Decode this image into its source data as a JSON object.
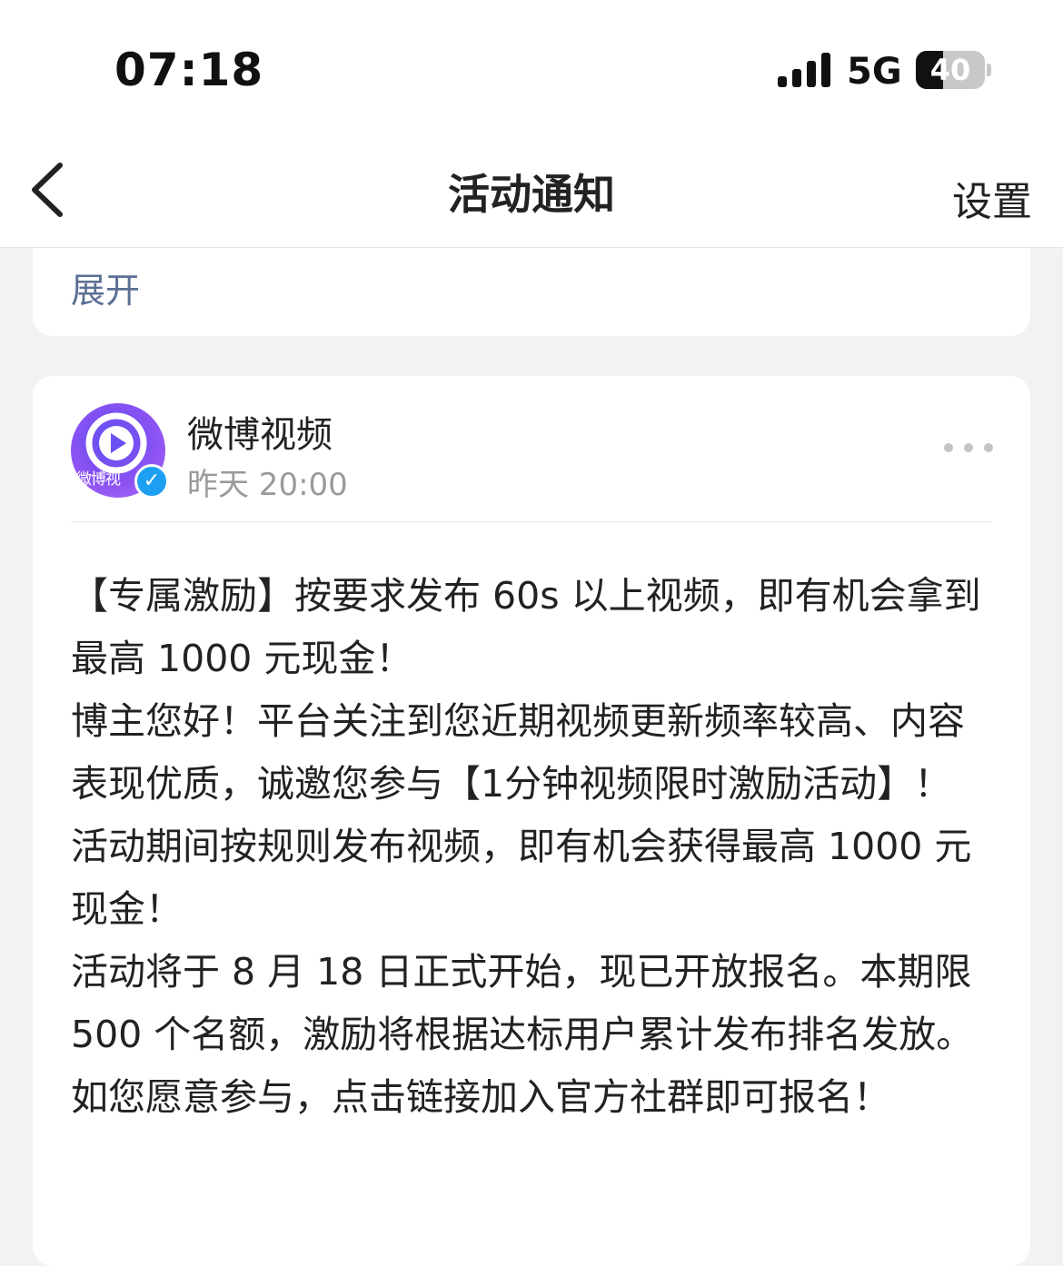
{
  "status_bar": {
    "time": "07:18",
    "network": "5G",
    "battery_level": "40",
    "battery_fraction": 0.4,
    "signal_bars": 4
  },
  "nav": {
    "title": "活动通知",
    "back_icon": "chevron-left-icon",
    "settings_label": "设置"
  },
  "previous_card": {
    "expand_label": "展开"
  },
  "message": {
    "sender": "微博视频",
    "avatar_caption": "微博视",
    "verified_mark": "✓",
    "time": "昨天 20:00",
    "more_icon": "more-dots-icon",
    "accent_color": "#1ea0f2",
    "paragraphs": [
      "【专属激励】按要求发布 60s 以上视频，即有机会拿到最高 1000 元现金！",
      "博主您好！平台关注到您近期视频更新频率较高、内容表现优质，诚邀您参与【1分钟视频限时激励活动】！",
      "活动期间按规则发布视频，即有机会获得最高 1000 元现金！",
      "活动将于 8 月 18 日正式开始，现已开放报名。本期限 500 个名额，激励将根据达标用户累计发布排名发放。",
      "如您愿意参与，点击链接加入官方社群即可报名！"
    ]
  }
}
